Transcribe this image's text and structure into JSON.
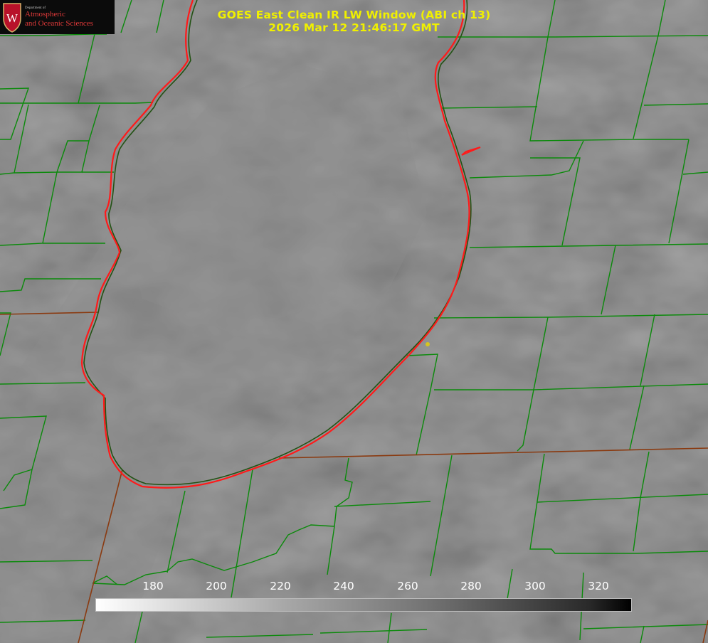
{
  "title": {
    "line1": "GOES East Clean IR LW Window (ABI ch 13)",
    "line2": "2026 Mar 12 21:46:17 GMT"
  },
  "logo": {
    "department": "Department of",
    "line1": "Atmospheric",
    "line2": "and Oceanic Sciences",
    "crest_letter": "W"
  },
  "colorbar": {
    "ticks": [
      "180",
      "200",
      "220",
      "240",
      "260",
      "280",
      "300",
      "320"
    ],
    "scale": "grayscale, white (cold) to black (warm)"
  },
  "map": {
    "county_border_color": "#0b8a0b",
    "state_border_color": "#8a3a10",
    "lake_outline_color": "#ff1a1a",
    "point_marker_color": "#d6c51e"
  }
}
